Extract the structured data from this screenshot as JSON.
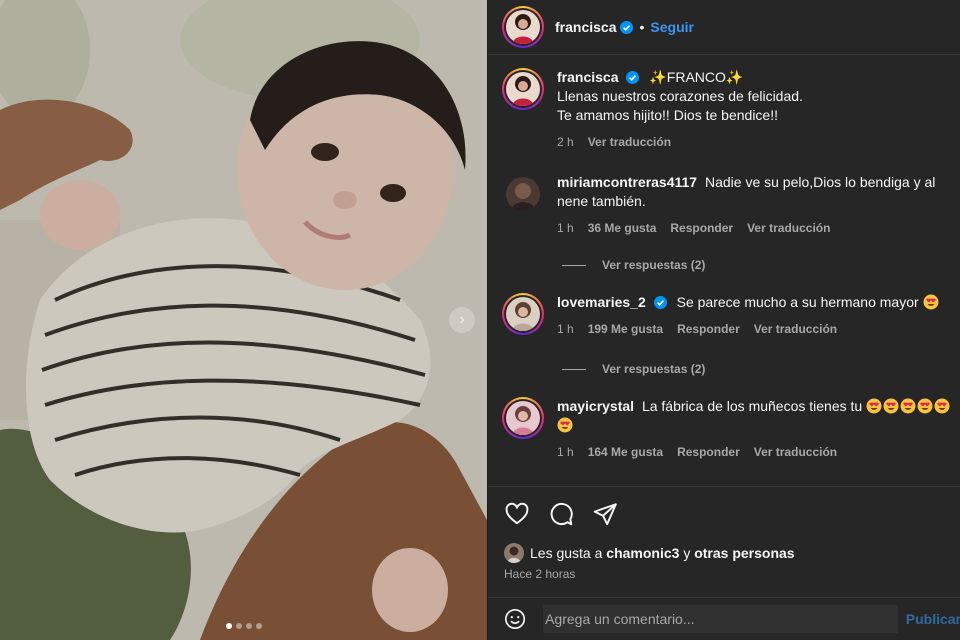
{
  "post": {
    "photo_alt": "",
    "carousel_dots": 4,
    "active_dot": 0,
    "next_icon": "chevron-right-icon"
  },
  "header": {
    "username": "francisca",
    "follow_label": "Seguir",
    "dot": "•"
  },
  "caption": {
    "username": "francisca",
    "line1": "✨FRANCO✨",
    "line2": "Llenas nuestros corazones de felicidad.",
    "line3": "Te amamos hijito!! Dios te bendice!!",
    "time": "2 h",
    "translate_label": "Ver traducción"
  },
  "comments": [
    {
      "username": "miriamcontreras4117",
      "text": "Nadie ve su pelo,Dios lo bendiga y al nene también.",
      "time": "1 h",
      "likes": "36 Me gusta",
      "reply_label": "Responder",
      "translate_label": "Ver traducción",
      "view_replies": "Ver respuestas (2)"
    },
    {
      "username": "lovemaries_2",
      "text": "Se parece mucho a su hermano mayor",
      "emoji": "heart-eyes-emoji",
      "time": "1 h",
      "likes": "199 Me gusta",
      "reply_label": "Responder",
      "translate_label": "Ver traducción",
      "view_replies": "Ver respuestas (2)"
    },
    {
      "username": "mayicrystal",
      "text": "La fábrica de los muñecos tienes tu",
      "emoji": "heart-eyes-emoji",
      "emoji_count": 6,
      "time": "1 h",
      "likes": "164 Me gusta",
      "reply_label": "Responder",
      "translate_label": "Ver traducción"
    }
  ],
  "actions": {
    "like_icon": "heart-icon",
    "comment_icon": "comment-icon",
    "share_icon": "send-icon",
    "likes_prefix": "Les gusta a",
    "likes_user": "chamonic3",
    "likes_joiner": "y",
    "likes_others": "otras personas",
    "timestamp": "Hace 2 horas"
  },
  "add_comment": {
    "emoji_icon": "smiley-icon",
    "placeholder": "Agrega un comentario...",
    "post_label": "Publicar"
  },
  "colors": {
    "panel_bg": "#262626",
    "accent": "#3797f0",
    "muted": "#a8a8a8",
    "verified": "#0095f6",
    "heart_eyes": "#f7c43b"
  }
}
